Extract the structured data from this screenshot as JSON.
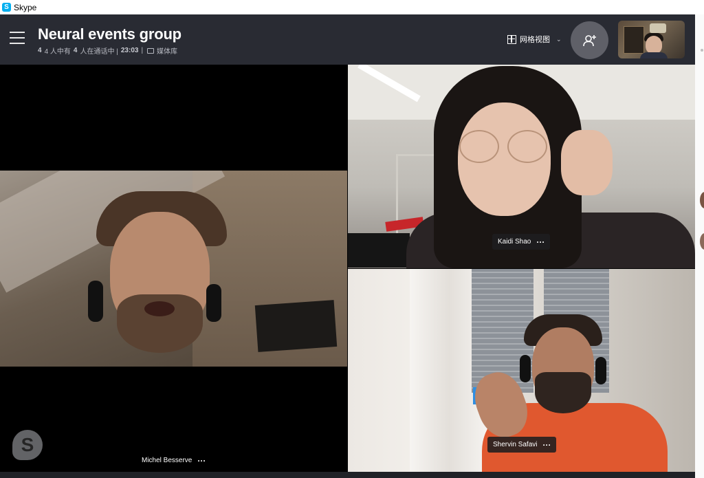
{
  "window": {
    "title": "Skype",
    "logo_letter": "S"
  },
  "header": {
    "group_name": "Neural events group",
    "subtitle": {
      "part1": "4 人中有",
      "part2": "4",
      "part3": "人在通话中 |",
      "duration": "23:03",
      "separator": "|",
      "media_label": "媒体库"
    },
    "view_mode_label": "网格视图",
    "add_person_icon": "add-person-icon"
  },
  "participants": [
    {
      "name": "Michel Besserve",
      "more": "···"
    },
    {
      "name": "Kaidi Shao",
      "more": "···"
    },
    {
      "name": "Shervin Safavi",
      "more": "···"
    }
  ],
  "watermark": {
    "letter": "S"
  },
  "colors": {
    "header_bg": "#292b33",
    "call_bg": "#000000",
    "skype_blue": "#00aff0",
    "add_button": "#5f6068"
  }
}
